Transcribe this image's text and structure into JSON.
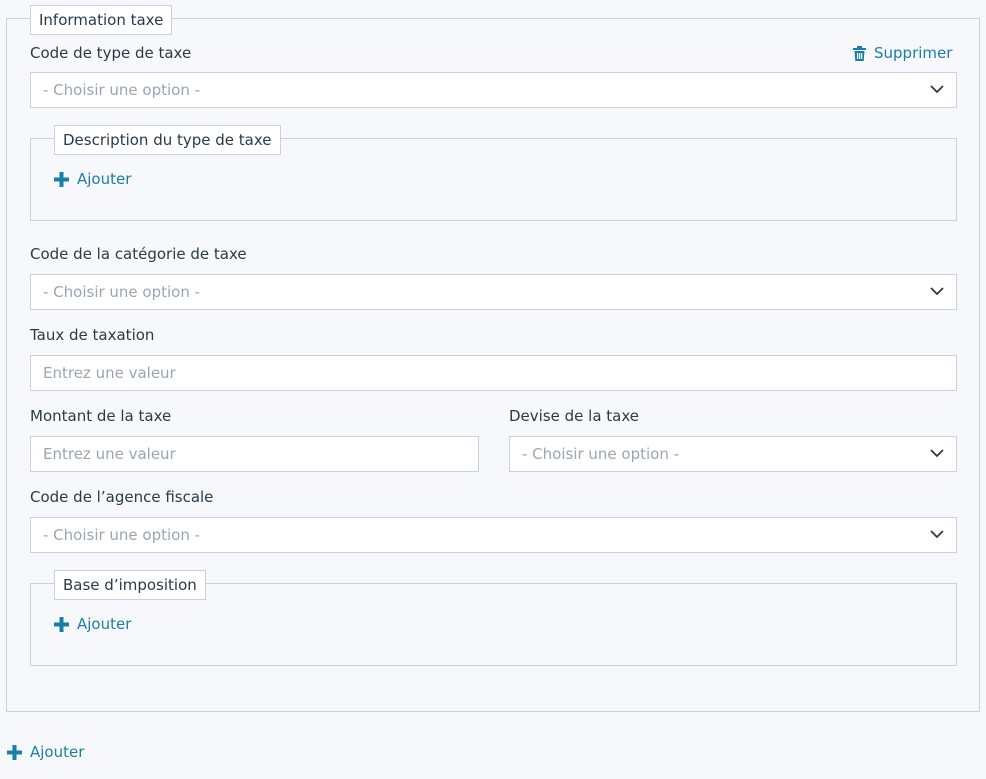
{
  "fieldset": {
    "legend": "Information taxe",
    "delete_label": "Supprimer"
  },
  "tax_type_code": {
    "label": "Code de type de taxe",
    "value": "- Choisir une option -"
  },
  "tax_type_description": {
    "legend": "Description du type de taxe",
    "add_label": "Ajouter"
  },
  "tax_category_code": {
    "label": "Code de la catégorie de taxe",
    "value": "- Choisir une option -"
  },
  "tax_rate": {
    "label": "Taux de taxation",
    "placeholder": "Entrez une valeur"
  },
  "tax_amount": {
    "label": "Montant de la taxe",
    "placeholder": "Entrez une valeur"
  },
  "tax_currency": {
    "label": "Devise de la taxe",
    "value": "- Choisir une option -"
  },
  "tax_agency_code": {
    "label": "Code de l’agence fiscale",
    "value": "- Choisir une option -"
  },
  "tax_base": {
    "legend": "Base d’imposition",
    "add_label": "Ajouter"
  },
  "footer": {
    "add_label": "Ajouter"
  },
  "colors": {
    "link": "#1a7fa6",
    "border": "#c6d3df",
    "background": "#f6f8fb"
  },
  "icons": [
    "trash-icon",
    "plus-icon",
    "chevron-down-icon"
  ]
}
